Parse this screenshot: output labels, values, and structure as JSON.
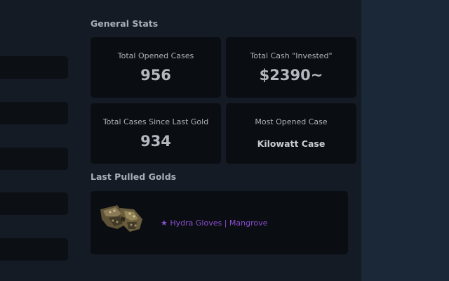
{
  "sections": {
    "general_stats_title": "General Stats",
    "last_golds_title": "Last Pulled Golds"
  },
  "stats": [
    {
      "label": "Total Opened Cases",
      "value": "956"
    },
    {
      "label": "Total Cash \"Invested\"",
      "value": "$2390~"
    },
    {
      "label": "Total Cases Since Last Gold",
      "value": "934"
    },
    {
      "label": "Most Opened Case",
      "value": "Kilowatt Case"
    }
  ],
  "last_golds": [
    {
      "name": "★ Hydra Gloves | Mangrove",
      "color": "#8a4fd0",
      "icon": "gloves-image"
    }
  ],
  "colors": {
    "background": "#151b24",
    "card": "#0a0d11",
    "side_panel": "#1b2838",
    "gold_name": "#8a4fd0"
  }
}
